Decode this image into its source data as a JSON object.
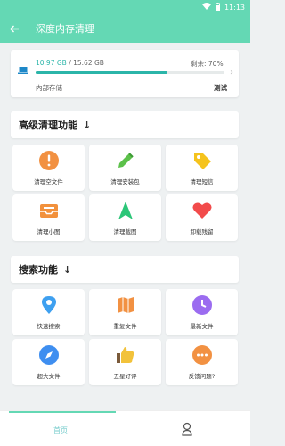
{
  "status_bar": {
    "time": "11:13"
  },
  "app_bar": {
    "title": "深度内存清理"
  },
  "storage": {
    "used": "10.97 GB",
    "separator": "/",
    "total": "15.62 GB",
    "remaining": "剩余: 70%",
    "progress_percent": 70,
    "label": "内部存储",
    "test_label": "测试"
  },
  "sections": {
    "advanced": {
      "title": "高级清理功能",
      "arrow": "↓"
    },
    "search": {
      "title": "搜索功能",
      "arrow": "↓"
    }
  },
  "advanced_tiles": [
    {
      "label": "清理空文件",
      "icon": "exclamation-icon",
      "color": "#f29142"
    },
    {
      "label": "清理安装包",
      "icon": "pencil-icon",
      "color": "#5cc14a"
    },
    {
      "label": "清理短信",
      "icon": "tag-icon",
      "color": "#f5c31d"
    },
    {
      "label": "清理小图",
      "icon": "inbox-icon",
      "color": "#f2913c"
    },
    {
      "label": "清理截图",
      "icon": "send-icon",
      "color": "#2cc678"
    },
    {
      "label": "卸载残留",
      "icon": "heart-icon",
      "color": "#f24b4b"
    }
  ],
  "search_tiles": [
    {
      "label": "快速搜索",
      "icon": "location-pin-icon",
      "color": "#3ea0f0"
    },
    {
      "label": "重复文件",
      "icon": "map-icon",
      "color": "#f29142"
    },
    {
      "label": "最新文件",
      "icon": "clock-icon",
      "color": "#9b6cf0"
    },
    {
      "label": "超大文件",
      "icon": "compass-icon",
      "color": "#3e8ef0"
    },
    {
      "label": "五星好评",
      "icon": "thumbs-up-icon",
      "color": "#f2c23a"
    },
    {
      "label": "反馈问题?",
      "icon": "more-bubble-icon",
      "color": "#f29142"
    }
  ],
  "bottom_nav": {
    "home": "首页"
  }
}
